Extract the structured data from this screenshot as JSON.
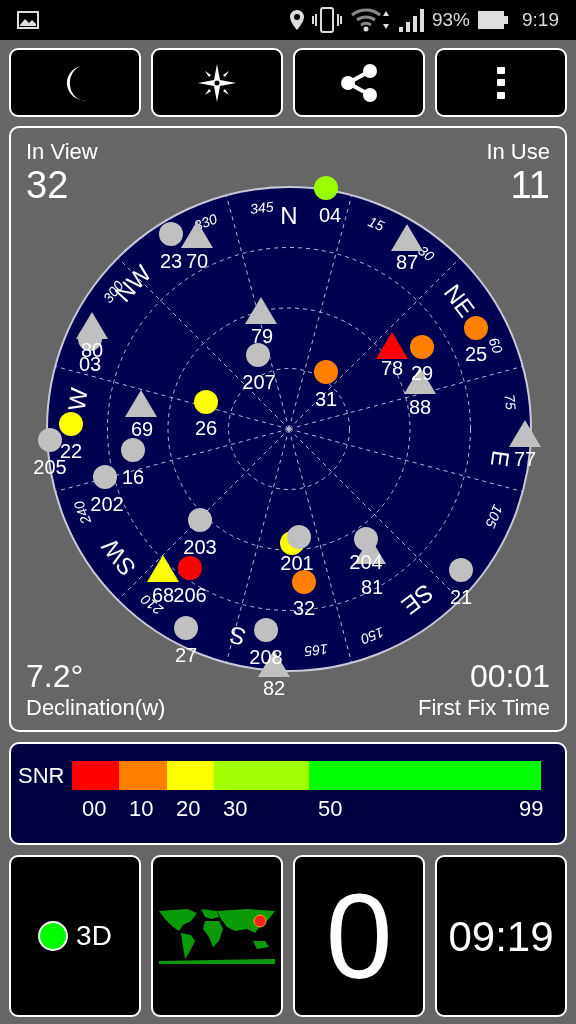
{
  "status_bar": {
    "battery": "93%",
    "time": "9:19"
  },
  "sky": {
    "in_view_label": "In View",
    "in_view": "32",
    "in_use_label": "In Use",
    "in_use": "11",
    "declination": "7.2°",
    "declination_label": "Declination(w)",
    "fix_time": "00:01",
    "fix_time_label": "First Fix Time",
    "compass": [
      "N",
      "NE",
      "E",
      "SE",
      "S",
      "SW",
      "W",
      "NW"
    ],
    "degrees": [
      "15",
      "30",
      "60",
      "75",
      "105",
      "150",
      "165",
      "210",
      "240",
      "300",
      "330",
      "345"
    ],
    "satellites": [
      {
        "label": "04",
        "kind": "circle",
        "color": "#99ff00"
      },
      {
        "label": "23",
        "kind": "circle",
        "color": "#c0c0c0"
      },
      {
        "label": "70",
        "kind": "triangle",
        "color": "#c0c0c0"
      },
      {
        "label": "87",
        "kind": "triangle",
        "color": "#c0c0c0"
      },
      {
        "label": "79",
        "kind": "triangle",
        "color": "#c0c0c0"
      },
      {
        "label": "80",
        "kind": "triangle",
        "color": "#c0c0c0"
      },
      {
        "label": "03",
        "kind": "circle",
        "color": "#c0c0c0"
      },
      {
        "label": "25",
        "kind": "circle",
        "color": "#ff8000"
      },
      {
        "label": "78",
        "kind": "triangle",
        "color": "#ff0000"
      },
      {
        "label": "29",
        "kind": "circle",
        "color": "#ff8000"
      },
      {
        "label": "207",
        "kind": "circle",
        "color": "#c0c0c0"
      },
      {
        "label": "88",
        "kind": "triangle",
        "color": "#c0c0c0"
      },
      {
        "label": "31",
        "kind": "circle",
        "color": "#ff8000"
      },
      {
        "label": "69",
        "kind": "triangle",
        "color": "#c0c0c0"
      },
      {
        "label": "26",
        "kind": "circle",
        "color": "#ffff00"
      },
      {
        "label": "77",
        "kind": "triangle",
        "color": "#c0c0c0"
      },
      {
        "label": "22",
        "kind": "circle",
        "color": "#ffff00"
      },
      {
        "label": "205",
        "kind": "circle",
        "color": "#c0c0c0"
      },
      {
        "label": "16",
        "kind": "circle",
        "color": "#c0c0c0"
      },
      {
        "label": "202",
        "kind": "circle",
        "color": "#c0c0c0"
      },
      {
        "label": "203",
        "kind": "circle",
        "color": "#c0c0c0"
      },
      {
        "kind": "circle",
        "color": "#ffff00"
      },
      {
        "label": "201",
        "kind": "circle",
        "color": "#c0c0c0"
      },
      {
        "label": "204",
        "kind": "circle",
        "color": "#c0c0c0"
      },
      {
        "label": "81",
        "kind": "triangle",
        "color": "#c0c0c0"
      },
      {
        "label": "68",
        "kind": "triangle",
        "color": "#ffff00"
      },
      {
        "label": "206",
        "kind": "circle",
        "color": "#ff0000"
      },
      {
        "label": "32",
        "kind": "circle",
        "color": "#ff8000"
      },
      {
        "label": "21",
        "kind": "circle",
        "color": "#c0c0c0"
      },
      {
        "label": "27",
        "kind": "circle",
        "color": "#c0c0c0"
      },
      {
        "label": "208",
        "kind": "circle",
        "color": "#c0c0c0"
      },
      {
        "label": "82",
        "kind": "triangle",
        "color": "#c0c0c0"
      }
    ]
  },
  "snr_legend": {
    "label": "SNR",
    "segments": [
      {
        "color": "#ff0000"
      },
      {
        "color": "#ff8000"
      },
      {
        "color": "#ffff00"
      },
      {
        "color": "#a0ff00"
      },
      {
        "color": "#00ff00"
      }
    ],
    "ticks": [
      "00",
      "10",
      "20",
      "30",
      "50",
      "99"
    ]
  },
  "tiles": {
    "fix": {
      "label": "3D",
      "color": "#00ff00"
    },
    "count": "0",
    "time": "09:19"
  }
}
